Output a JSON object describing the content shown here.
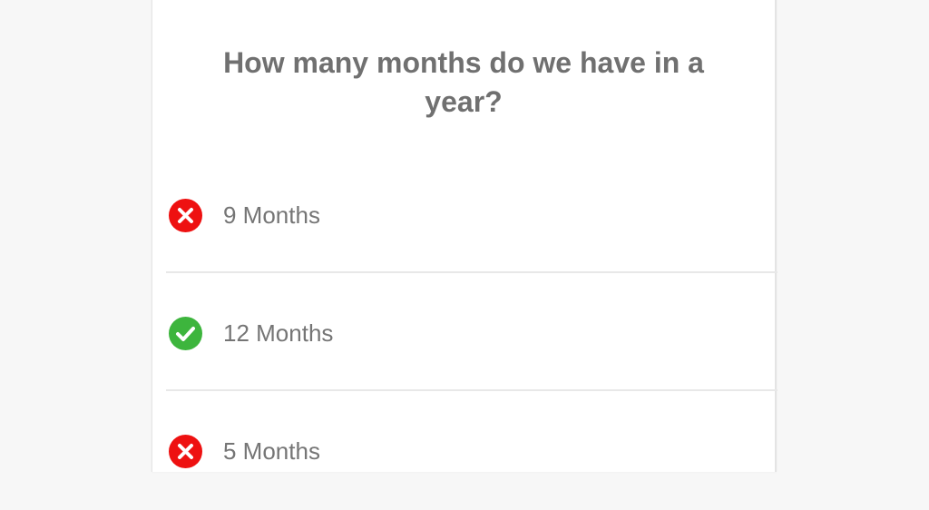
{
  "quiz": {
    "question": "How many months do we have in a year?",
    "options": [
      {
        "label": "9 Months",
        "state": "incorrect",
        "icon": "cross-icon"
      },
      {
        "label": "12 Months",
        "state": "correct",
        "icon": "check-icon"
      },
      {
        "label": "5 Months",
        "state": "incorrect",
        "icon": "cross-icon"
      }
    ]
  },
  "colors": {
    "incorrect": "#ee1111",
    "correct": "#3db53d",
    "text": "#757575",
    "page_background": "#f7f7f7",
    "card_background": "#ffffff"
  }
}
